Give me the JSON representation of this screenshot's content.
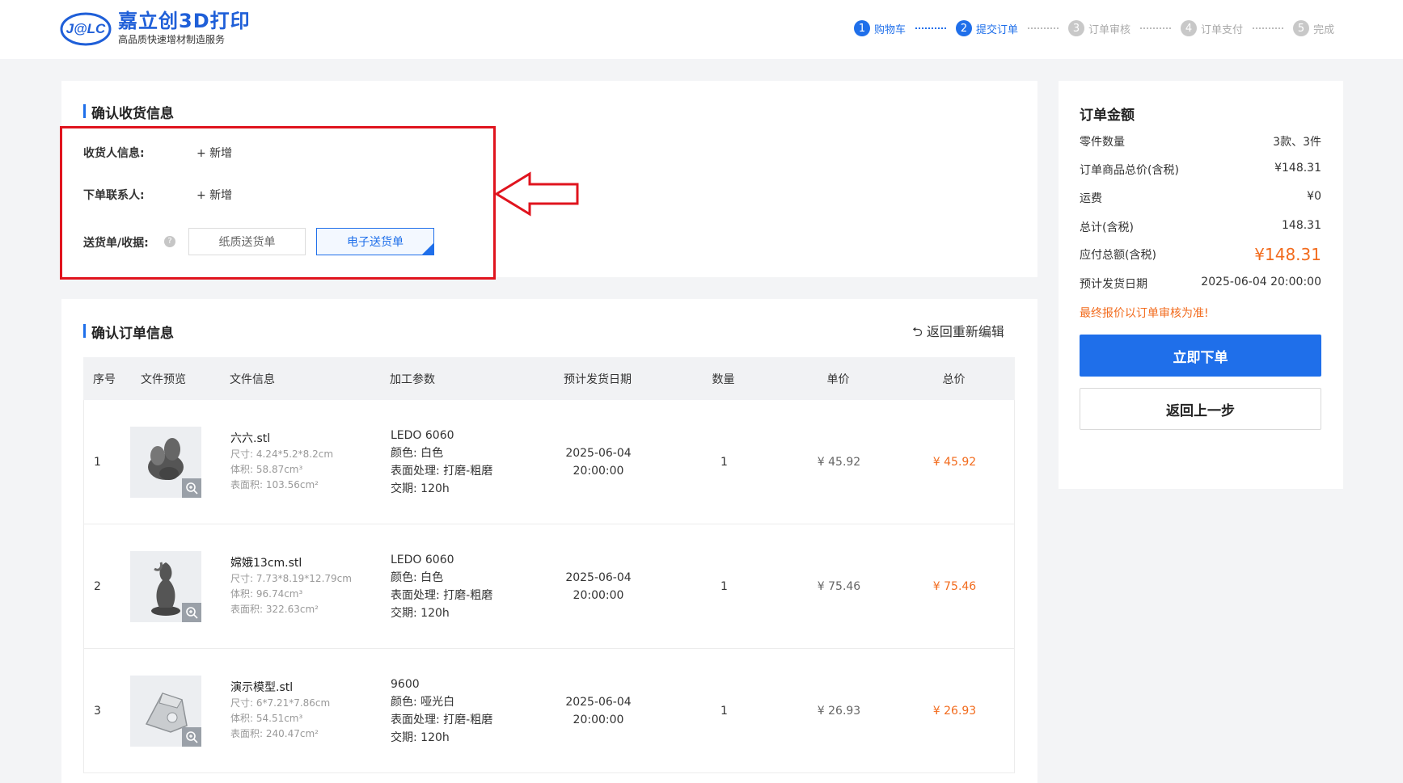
{
  "header": {
    "logo_mark": "J@LC",
    "logo_title": "嘉立创3D打印",
    "logo_subtitle": "高品质快速增材制造服务",
    "steps": [
      {
        "num": "1",
        "label": "购物车"
      },
      {
        "num": "2",
        "label": "提交订单"
      },
      {
        "num": "3",
        "label": "订单审核"
      },
      {
        "num": "4",
        "label": "订单支付"
      },
      {
        "num": "5",
        "label": "完成"
      }
    ]
  },
  "shipping": {
    "title": "确认收货信息",
    "receiver_label": "收货人信息:",
    "receiver_add": "+  新增",
    "contact_label": "下单联系人:",
    "contact_add": "+  新增",
    "delivery_label": "送货单/收据:",
    "help_icon": "?",
    "options": [
      "纸质送货单",
      "电子送货单"
    ],
    "selected_option": "电子送货单"
  },
  "order": {
    "title": "确认订单信息",
    "back_edit": "⮌ 返回重新编辑",
    "columns": [
      "序号",
      "文件预览",
      "文件信息",
      "加工参数",
      "预计发货日期",
      "数量",
      "单价",
      "总价"
    ],
    "rows": [
      {
        "idx": "1",
        "file_name": "六六.stl",
        "size": "尺寸:  4.24*5.2*8.2cm",
        "volume": "体积:  58.87cm³",
        "surface": "表面积:  103.56cm²",
        "material": "LEDO 6060",
        "color": "颜色:  白色",
        "finish": "表面处理:  打磨-粗磨",
        "lead": "交期:  120h",
        "date": "2025-06-04",
        "time": "20:00:00",
        "qty": "1",
        "unit_price": "¥ 45.92",
        "total": "¥ 45.92"
      },
      {
        "idx": "2",
        "file_name": "嫦娥13cm.stl",
        "size": "尺寸:  7.73*8.19*12.79cm",
        "volume": "体积:  96.74cm³",
        "surface": "表面积:  322.63cm²",
        "material": "LEDO 6060",
        "color": "颜色:  白色",
        "finish": "表面处理:  打磨-粗磨",
        "lead": "交期:  120h",
        "date": "2025-06-04",
        "time": "20:00:00",
        "qty": "1",
        "unit_price": "¥ 75.46",
        "total": "¥ 75.46"
      },
      {
        "idx": "3",
        "file_name": "演示模型.stl",
        "size": "尺寸:  6*7.21*7.86cm",
        "volume": "体积:  54.51cm³",
        "surface": "表面积:  240.47cm²",
        "material": "9600",
        "color": "颜色:  哑光白",
        "finish": "表面处理:  打磨-粗磨",
        "lead": "交期:  120h",
        "date": "2025-06-04",
        "time": "20:00:00",
        "qty": "1",
        "unit_price": "¥ 26.93",
        "total": "¥ 26.93"
      }
    ]
  },
  "summary": {
    "title": "订单金额",
    "parts_label": "零件数量",
    "parts_value": "3款、3件",
    "goods_label": "订单商品总价(含税)",
    "goods_value": "¥148.31",
    "shipping_label": "运费",
    "shipping_value": "¥0",
    "total_label": "总计(含税)",
    "total_value": "148.31",
    "payable_label": "应付总额(含税)",
    "payable_value": "¥148.31",
    "ship_date_label": "预计发货日期",
    "ship_date_value": "2025-06-04 20:00:00",
    "notice": "最终报价以订单审核为准!",
    "submit_button": "立即下单",
    "back_button": "返回上一步"
  },
  "colors": {
    "primary": "#1f6fea",
    "accent_orange": "#f26b1d",
    "highlight_red": "#e0141e"
  }
}
